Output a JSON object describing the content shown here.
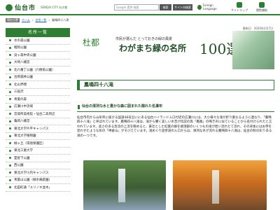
{
  "header": {
    "city_name": "仙台市",
    "city_sub": "SENDAI CITY 杜の都",
    "search_placeholder": "Google 提供 検索",
    "search_button": "検索",
    "site_button": "サイト内検索",
    "language": "Foreign Language",
    "icons": [
      {
        "label": "サイトマップ"
      },
      {
        "label": "閲覧補助"
      }
    ]
  },
  "breadcrumb": {
    "tag": "現在位置",
    "items": [
      "ホーム",
      "名所一覧",
      "鳳鳴四十八滝"
    ]
  },
  "date": "更新日：2020年2月7日",
  "sidebar": {
    "title": "名所一覧",
    "items": [
      "水の森公園",
      "榴岡公園",
      "貝ヶ森中央公園",
      "大崎八幡宮",
      "北六番丁公園（六樹角公園）",
      "台原森林公園",
      "北山界隈",
      "三居沢",
      "青葉の森",
      "広瀬川中流域",
      "宮城県美術館・仙台二高周辺",
      "亀岡八幡宮",
      "東北大学片平キャンパス",
      "東北大学植物園",
      "緑ヶ丘（環境保護区）",
      "東北工業大学",
      "霊屋下公園",
      "西公園",
      "東北大学川内キャンパス",
      "青葉山公園（緑水庵庭園）",
      "北田町通「ユリノキ並木」"
    ]
  },
  "banner": {
    "logo": "杜都",
    "subtitle": "市民が選んだ とっておきの緑の風景",
    "title": "わがまち緑の名所",
    "number": "100選"
  },
  "page": {
    "title": "鳳鳴四十八滝",
    "subheading": "仙台の清冽な水と豊かな森に囲まれた隠れた名瀑布",
    "body": "仙台市内から山形県に抜ける国道48号沿いにある仙台ハイランド入口付近の広瀬川には、大小様々な滝が折り重なるように連なり、「鳳鳴四十八滝」と呼ばれています。鳳鳴四十八滝は、滝から響く美しい水音が伝説の鳥「鳳凰」の鳴き声に似ていることから名付けられたと言われています。高さのある急流の上流を眺めると、豪壮とした紅葉の群を頭頂部のいくつもの滝が岩い流れたて流れ、その背後にはお寺を思わせたような形の「禅倉山」がそびえています。滝めぐり遊歩道の入口からは、清冽な水が流れる鳳鳴四十八滝は、仙台の秋の彩りある滝の一つです。"
  }
}
